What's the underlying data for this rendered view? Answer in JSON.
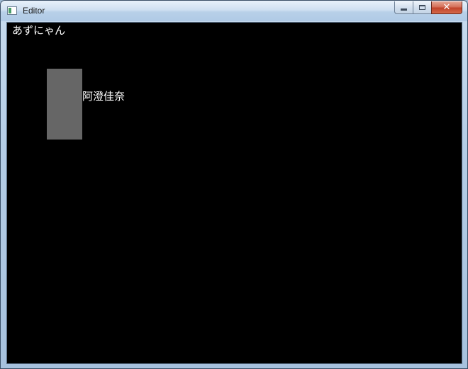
{
  "window": {
    "title": "Editor"
  },
  "caption_buttons": {
    "minimize_icon": "minimize-icon",
    "maximize_icon": "maximize-icon",
    "close_icon": "close-icon",
    "close_glyph": "✕"
  },
  "canvas": {
    "background": "#000000",
    "top_text": "あずにゃん",
    "rect_color": "#666666",
    "name_text": "阿澄佳奈"
  }
}
